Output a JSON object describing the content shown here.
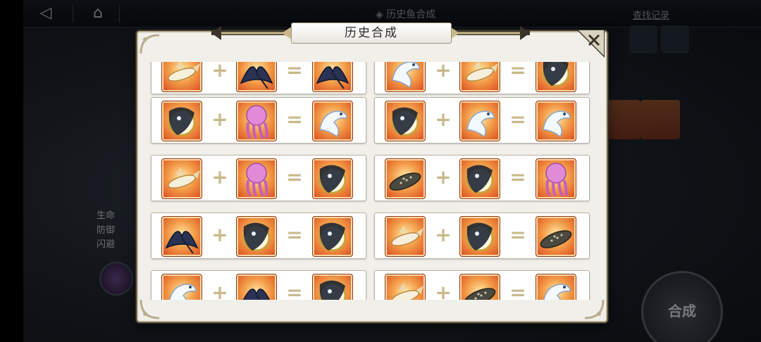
{
  "topbar": {
    "back_icon": "back-arrow-icon",
    "home_icon": "home-icon",
    "title": "◈ 历史鱼合成",
    "search_link": "查找记录"
  },
  "background": {
    "stats": [
      "生命",
      "防御",
      "闪避"
    ],
    "merge_button_label": "合成"
  },
  "modal": {
    "title": "历史合成",
    "close_icon": "close-icon",
    "plus_symbol": "+",
    "equals_symbol": "="
  },
  "recipes": [
    {
      "a": "tiger-shark",
      "b": "dark-manta",
      "result": "dark-manta"
    },
    {
      "a": "white-dragon-fish",
      "b": "tiger-shark",
      "result": "black-gold-serpent"
    },
    {
      "a": "black-gold-serpent",
      "b": "pink-octopus",
      "result": "white-dragon-fish"
    },
    {
      "a": "black-gold-serpent",
      "b": "white-dragon-fish",
      "result": "white-dragon-fish"
    },
    {
      "a": "tiger-shark",
      "b": "pink-octopus",
      "result": "black-gold-serpent"
    },
    {
      "a": "whale-shark",
      "b": "black-gold-serpent",
      "result": "pink-octopus"
    },
    {
      "a": "dark-manta",
      "b": "black-gold-serpent",
      "result": "black-gold-serpent"
    },
    {
      "a": "tiger-shark",
      "b": "black-gold-serpent",
      "result": "whale-shark"
    },
    {
      "a": "white-dragon-fish",
      "b": "dark-manta",
      "result": "black-gold-serpent"
    },
    {
      "a": "tiger-shark",
      "b": "whale-shark",
      "result": "white-dragon-fish"
    }
  ],
  "colors": {
    "card_fire": "#e8602a",
    "modal_bg": "#f1efe9",
    "gold_trim": "#c9b98b"
  }
}
